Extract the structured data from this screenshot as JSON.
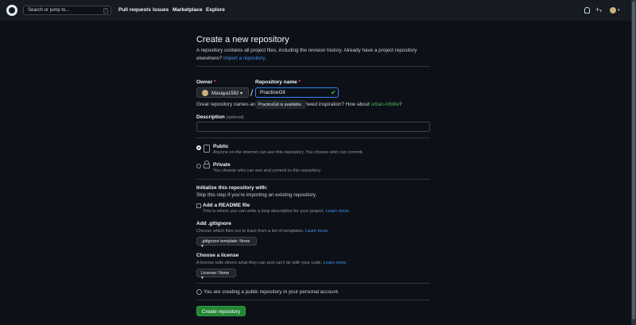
{
  "header": {
    "search_placeholder": "Search or jump to...",
    "search_shortcut": "/",
    "nav": [
      "Pull requests",
      "Issues",
      "Marketplace",
      "Explore"
    ]
  },
  "page": {
    "title": "Create a new repository",
    "intro": "A repository contains all project files, including the revision history. Already have a project repository elsewhere?",
    "import_link": "Import a repository."
  },
  "owner": {
    "label": "Owner",
    "value": "Masaya1582",
    "required_mark": "*"
  },
  "repo_name": {
    "label": "Repository name",
    "value": "PracticeGit",
    "required_mark": "*",
    "available_tooltip": "PracticeGit is available.",
    "hint_prefix": "Great repository names are",
    "hint_mid": "Need inspiration? How about",
    "suggestion": "urban-tribble",
    "suggestion_suffix": "?"
  },
  "description": {
    "label": "Description",
    "optional": "(optional)"
  },
  "visibility": {
    "public_label": "Public",
    "public_desc": "Anyone on the internet can see this repository. You choose who can commit.",
    "private_label": "Private",
    "private_desc": "You choose who can see and commit to this repository."
  },
  "init": {
    "title": "Initialize this repository with:",
    "subtitle": "Skip this step if you're importing an existing repository.",
    "readme_label": "Add a README file",
    "readme_desc": "This is where you can write a long description for your project.",
    "readme_link": "Learn more.",
    "gitignore_label": "Add .gitignore",
    "gitignore_desc": "Choose which files not to track from a list of templates.",
    "gitignore_link": "Learn more.",
    "gitignore_dropdown": ".gitignore template: None",
    "license_label": "Choose a license",
    "license_desc": "A license tells others what they can and can't do with your code.",
    "license_link": "Learn more.",
    "license_dropdown": "License: None"
  },
  "notice": "You are creating a public repository in your personal account.",
  "create_button": "Create repository",
  "colors": {
    "background": "#0d1117",
    "header": "#161b22",
    "link": "#4493f8",
    "primary_button": "#238636",
    "success": "#3fb950",
    "required": "#f85149"
  }
}
